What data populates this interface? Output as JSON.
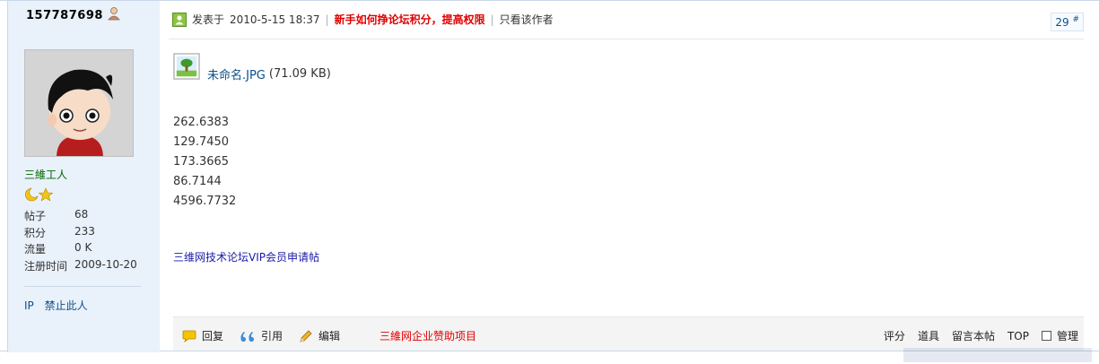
{
  "sidebar": {
    "username": "157787698",
    "rank": "三維工人",
    "stats": [
      {
        "label": "帖子",
        "value": "68"
      },
      {
        "label": "积分",
        "value": "233"
      },
      {
        "label": "流量",
        "value": "0 K"
      },
      {
        "label": "注册时间",
        "value": "2009-10-20"
      }
    ],
    "links": {
      "ip": "IP",
      "ban": "禁止此人"
    }
  },
  "post": {
    "posted_label": "发表于",
    "posted_time": "2010-5-15 18:37",
    "promo_link": "新手如何挣论坛积分，提高权限",
    "author_only": "只看该作者",
    "floor_number": "29",
    "floor_symbol": "#",
    "attachment": {
      "name": "未命名.JPG",
      "size": "(71.09 KB)"
    },
    "values": [
      "262.6383",
      "129.7450",
      "173.3665",
      "86.7144",
      "4596.7732"
    ],
    "signature": "三维网技术论坛VIP会员申请帖"
  },
  "actions": {
    "reply": "回复",
    "quote": "引用",
    "edit": "编辑",
    "sponsor": "三維网企业赞助项目",
    "rate": "评分",
    "tools": "道具",
    "comment": "留言本帖",
    "top": "TOP",
    "manage": "管理"
  },
  "colors": {
    "sidebar_bg": "#e9f1fb",
    "link": "#0c4f8a",
    "promo": "#e00000",
    "rank": "#006600"
  }
}
